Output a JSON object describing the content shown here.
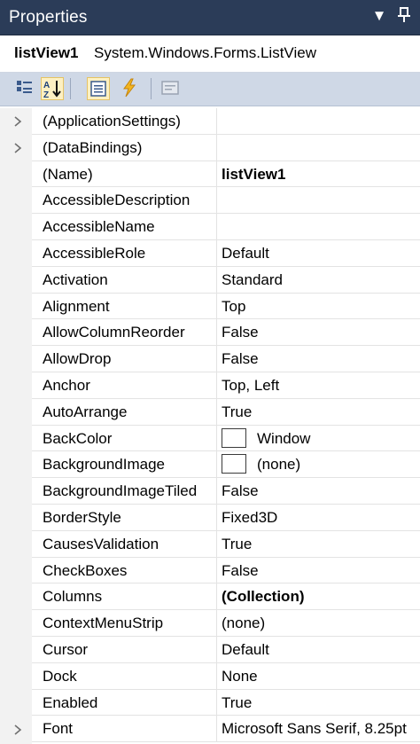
{
  "window": {
    "title": "Properties",
    "dropdown_glyph": "▼",
    "pin_glyph": "⊥"
  },
  "object": {
    "name": "listView1",
    "type": "System.Windows.Forms.ListView"
  },
  "toolbar": {
    "buttons": [
      {
        "icon": "categorized-icon",
        "active": false
      },
      {
        "icon": "alphabetical-icon",
        "active": true
      },
      {
        "icon": "properties-icon",
        "active": true
      },
      {
        "icon": "events-icon",
        "active": false
      },
      {
        "icon": "property-pages-icon",
        "active": false
      }
    ]
  },
  "properties": [
    {
      "name": "(ApplicationSettings)",
      "value": "",
      "expandable": true
    },
    {
      "name": "(DataBindings)",
      "value": "",
      "expandable": true
    },
    {
      "name": "(Name)",
      "value": "listView1",
      "bold": true
    },
    {
      "name": "AccessibleDescription",
      "value": ""
    },
    {
      "name": "AccessibleName",
      "value": ""
    },
    {
      "name": "AccessibleRole",
      "value": "Default"
    },
    {
      "name": "Activation",
      "value": "Standard"
    },
    {
      "name": "Alignment",
      "value": "Top"
    },
    {
      "name": "AllowColumnReorder",
      "value": "False"
    },
    {
      "name": "AllowDrop",
      "value": "False"
    },
    {
      "name": "Anchor",
      "value": "Top, Left"
    },
    {
      "name": "AutoArrange",
      "value": "True"
    },
    {
      "name": "BackColor",
      "value": "Window",
      "swatch": "#ffffff"
    },
    {
      "name": "BackgroundImage",
      "value": "(none)",
      "swatch": "#ffffff"
    },
    {
      "name": "BackgroundImageTiled",
      "value": "False"
    },
    {
      "name": "BorderStyle",
      "value": "Fixed3D"
    },
    {
      "name": "CausesValidation",
      "value": "True"
    },
    {
      "name": "CheckBoxes",
      "value": "False"
    },
    {
      "name": "Columns",
      "value": "(Collection)",
      "bold": true
    },
    {
      "name": "ContextMenuStrip",
      "value": "(none)"
    },
    {
      "name": "Cursor",
      "value": "Default"
    },
    {
      "name": "Dock",
      "value": "None"
    },
    {
      "name": "Enabled",
      "value": "True"
    },
    {
      "name": "Font",
      "value": "Microsoft Sans Serif, 8.25pt",
      "expandable": true
    }
  ],
  "colors": {
    "titlebar": "#2b3c58",
    "toolbar": "#cfd8e6",
    "gridline": "#e3e3e3"
  }
}
